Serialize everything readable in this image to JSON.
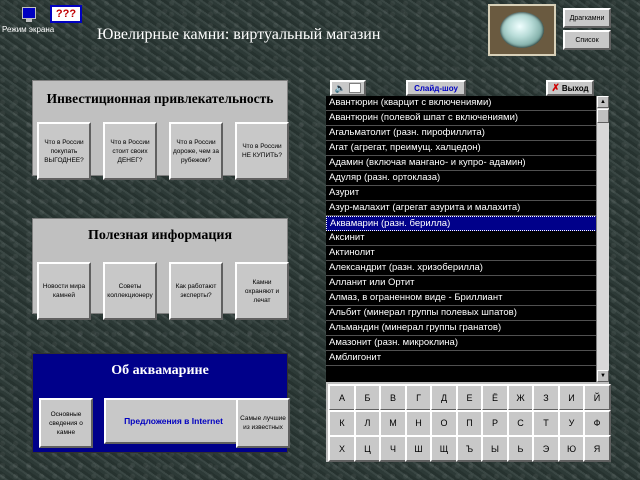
{
  "header": {
    "screen_mode_label": "Режим экрана",
    "help_button": "???",
    "title": "Ювелирные камни: виртуальный магазин",
    "side_buttons": [
      "Драгкамни",
      "Список"
    ]
  },
  "investment_panel": {
    "title": "Инвестиционная привлекательность",
    "buttons": [
      "Что в России покупать ВЫГОДНЕЕ?",
      "Что в России стоит своих ДЕНЕГ?",
      "Что в России дороже, чем за рубежом?",
      "Что в России НЕ КУПИТЬ?"
    ]
  },
  "info_panel": {
    "title": "Полезная информация",
    "buttons": [
      "Новости мира камней",
      "Советы коллекционеру",
      "Как работают эксперты?",
      "Камни охраняют и лечат"
    ]
  },
  "about_panel": {
    "title": "Об аквамарине",
    "left_button": "Основные сведения о камне",
    "center_button": "Предложения в Internet",
    "right_button": "Самые лучшие из известных"
  },
  "toolbar": {
    "sound_icon": "speaker-icon",
    "slideshow": "Слайд-шоу",
    "exit": "Выход",
    "exit_mark": "✗"
  },
  "stone_list": {
    "selected_index": 9,
    "items": [
      "Авантюрин (кварцит с включениями)",
      "Авантюрин (полевой шпат с включениями)",
      "Агальматолит (разн. пирофиллита)",
      "Агат (агрегат, преимущ. халцедон)",
      "Адамин (включая мангано- и купро- адамин)",
      "Адуляр (разн. ортоклаза)",
      "Азурит",
      "Азур-малахит (агрегат азурита и малахита)",
      "Аквамарин (разн. берилла)",
      "Аквамарин (разн. берилла)",
      "Аксинит",
      "Актинолит",
      "Александрит (разн. хризоберилла)",
      "Алланит или Ортит",
      "Алмаз, в ограненном виде - Бриллиант",
      "Альбит (минерал группы полевых шпатов)",
      "Альмандин (минерал группы гранатов)",
      "Амазонит (разн. микроклина)",
      "Амблигонит"
    ]
  },
  "scrollbar": {
    "up_arrow": "▲",
    "down_arrow": "▼"
  },
  "alphabet": [
    [
      "А",
      "Б",
      "В",
      "Г",
      "Д",
      "Е",
      "Ё",
      "Ж",
      "З",
      "И",
      "Й"
    ],
    [
      "К",
      "Л",
      "М",
      "Н",
      "О",
      "П",
      "Р",
      "С",
      "Т",
      "У",
      "Ф"
    ],
    [
      "Х",
      "Ц",
      "Ч",
      "Ш",
      "Щ",
      "Ъ",
      "Ы",
      "Ь",
      "Э",
      "Ю",
      "Я"
    ]
  ]
}
